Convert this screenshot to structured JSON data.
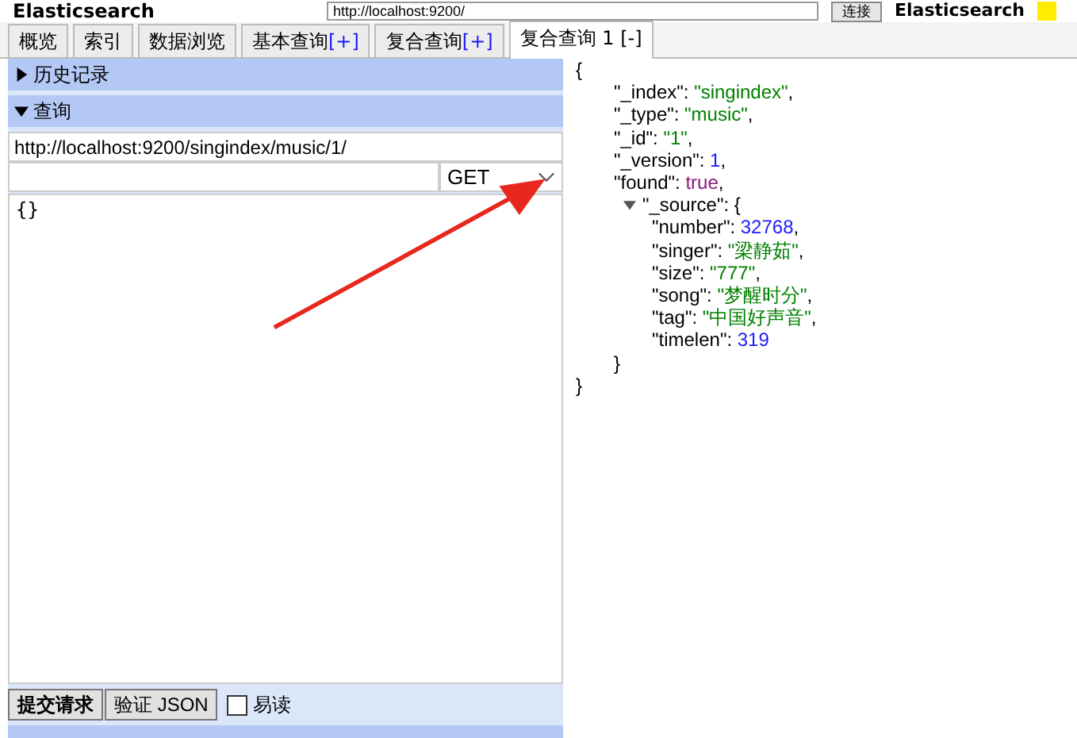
{
  "header": {
    "title": "Elasticsearch",
    "url": "http://localhost:9200/",
    "connect_button": "连接",
    "cluster_name": "Elasticsearch"
  },
  "tabs": [
    {
      "label": "概览",
      "selected": false
    },
    {
      "label": "索引",
      "selected": false
    },
    {
      "label": "数据浏览",
      "selected": false
    },
    {
      "label": "基本查询",
      "plus": "[+]",
      "selected": false
    },
    {
      "label": "复合查询",
      "plus": "[+]",
      "selected": false
    },
    {
      "label": "复合查询 1 [-]",
      "selected": true
    }
  ],
  "sections": [
    {
      "label": "历史记录",
      "expanded": false
    },
    {
      "label": "查询",
      "expanded": true
    }
  ],
  "query": {
    "url": "http://localhost:9200/singindex/music/1/",
    "method": "GET",
    "body": "{}"
  },
  "buttons": [
    "提交请求",
    "验证 JSON"
  ],
  "pretty": {
    "label": "易读",
    "checked": false
  },
  "result": {
    "open": "{",
    "close": "}",
    "lines": [
      {
        "key": "\"_index\":",
        "kind": "string",
        "value": "\"singindex\"",
        "tail": ","
      },
      {
        "key": "\"_type\":",
        "kind": "string",
        "value": "\"music\"",
        "tail": ","
      },
      {
        "key": "\"_id\":",
        "kind": "string",
        "value": "\"1\"",
        "tail": ","
      },
      {
        "key": "\"_version\":",
        "kind": "number",
        "value": "1",
        "tail": ","
      },
      {
        "key": "\"found\":",
        "kind": "bool",
        "value": "true",
        "tail": ","
      },
      {
        "key": "\"_source\":",
        "kind": "object",
        "expanded": true,
        "open": "{",
        "close": "}",
        "children": [
          {
            "key": "\"number\":",
            "kind": "number",
            "value": "32768",
            "tail": ","
          },
          {
            "key": "\"singer\":",
            "kind": "string",
            "value": "\"梁静茹\"",
            "tail": ","
          },
          {
            "key": "\"size\":",
            "kind": "string",
            "value": "\"777\"",
            "tail": ","
          },
          {
            "key": "\"song\":",
            "kind": "string",
            "value": "\"梦醒时分\"",
            "tail": ","
          },
          {
            "key": "\"tag\":",
            "kind": "string",
            "value": "\"中国好声音\"",
            "tail": ","
          },
          {
            "key": "\"timelen\":",
            "kind": "number",
            "value": "319"
          }
        ]
      }
    ]
  }
}
